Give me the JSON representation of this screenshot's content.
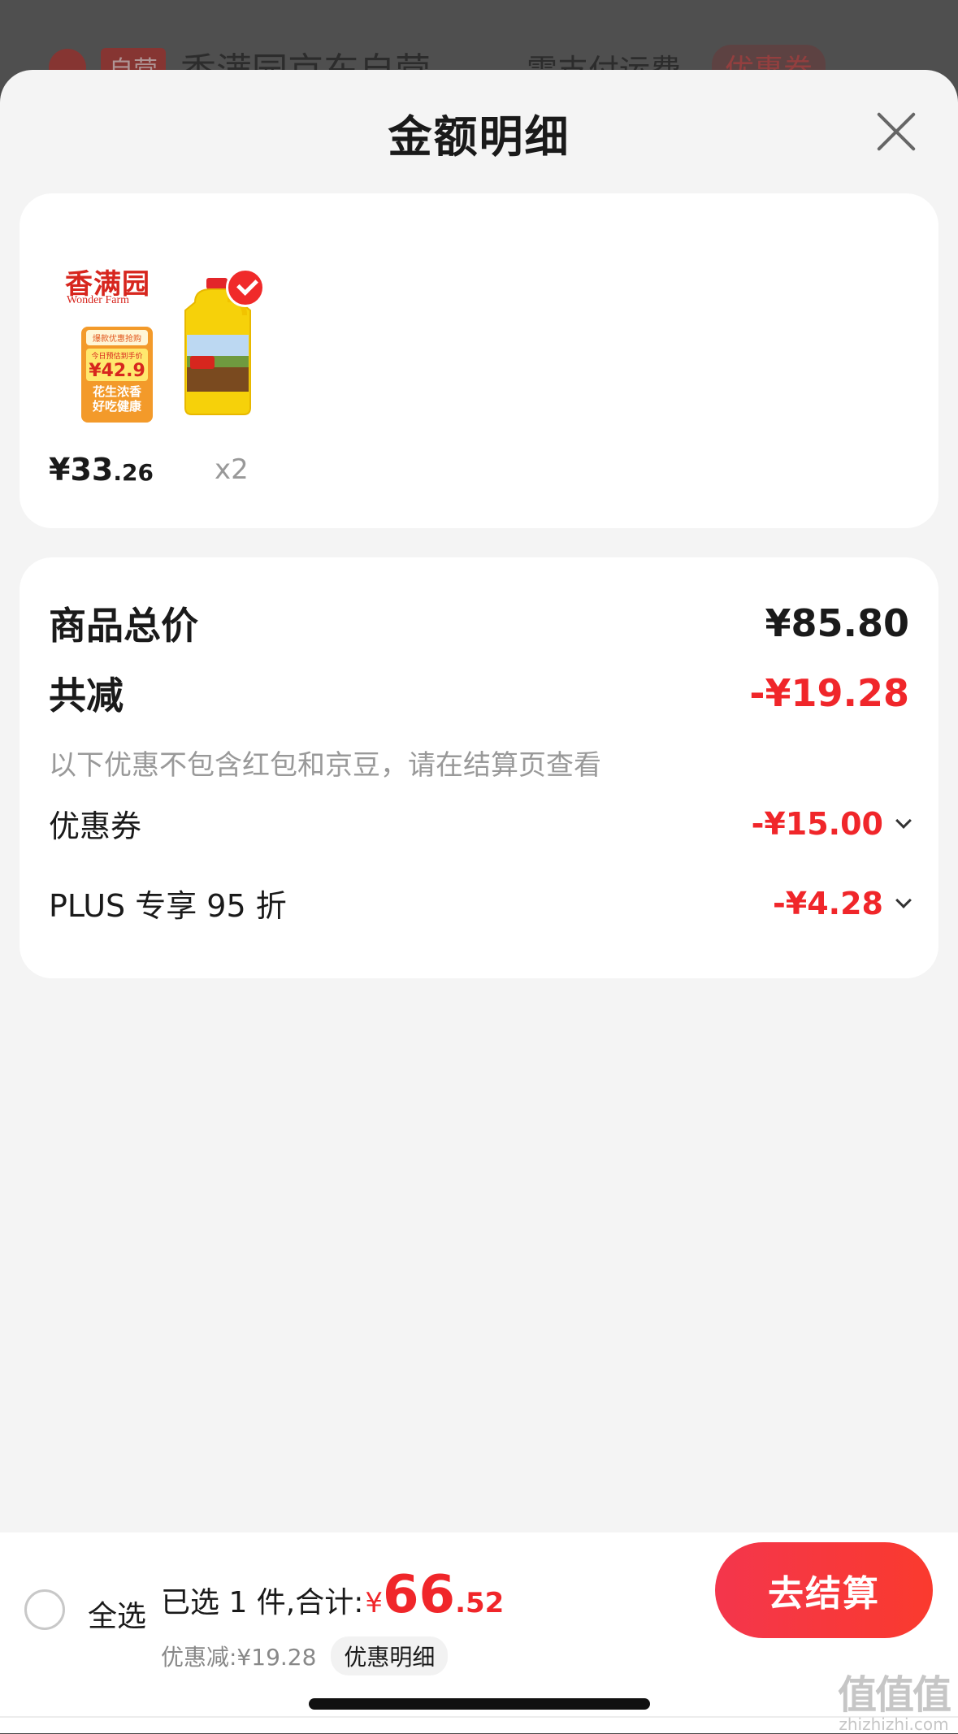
{
  "background": {
    "tag": "自营",
    "store_name": "香满园京东自营",
    "fee": "需支付运费",
    "coupon": "优惠券"
  },
  "sheet": {
    "title": "金额明细"
  },
  "product": {
    "brand_cn": "香满园",
    "brand_en": "Wonder Farm",
    "promo_top": "爆款优惠抢购",
    "promo_price_caption": "今日预估到手价",
    "promo_price": "¥42.9",
    "promo_bottom_1": "花生浓香",
    "promo_bottom_2": "好吃健康",
    "price_int": "¥33",
    "price_dec": ".26",
    "quantity": "x2"
  },
  "summary": {
    "total_label": "商品总价",
    "total_value": "¥85.80",
    "reduce_label": "共减",
    "reduce_value": "-¥19.28",
    "note": "以下优惠不包含红包和京豆，请在结算页查看",
    "coupon_label": "优惠券",
    "coupon_value": "-¥15.00",
    "plus_label": "PLUS 专享 95 折",
    "plus_value": "-¥4.28"
  },
  "bottom_bar": {
    "select_all": "全选",
    "selected_text": "已选 1 件,合计:",
    "total_currency": "¥",
    "total_int": "66",
    "total_dec": ".52",
    "discount_text": "优惠减:¥19.28",
    "discount_detail": "优惠明细",
    "checkout": "去结算"
  },
  "watermark": {
    "logo": "值值值",
    "url": "zhizhizhi.com"
  },
  "colors": {
    "accent_red": "#f0262a",
    "checkout_gradient_start": "#f4364c",
    "checkout_gradient_end": "#fa3a2e"
  }
}
